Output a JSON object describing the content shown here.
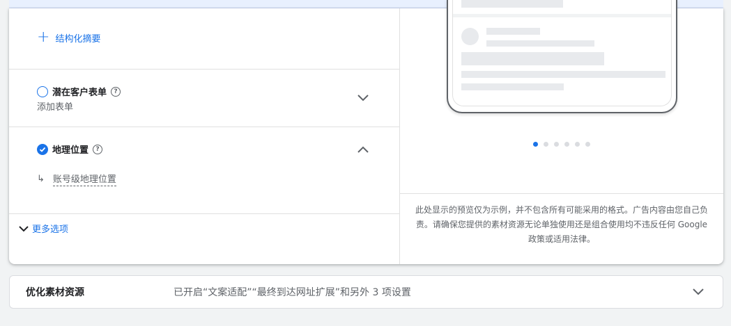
{
  "structured_snippet": {
    "label": "结构化摘要"
  },
  "lead_form": {
    "title": "潜在客户表单",
    "subtitle": "添加表单",
    "help": "?"
  },
  "location": {
    "title": "地理位置",
    "link": "账号级地理位置",
    "arrow": "↳",
    "help": "?"
  },
  "more_options": {
    "label": "更多选项"
  },
  "preview": {
    "disclaimer": "此处显示的预览仅为示例，并不包含所有可能采用的格式。广告内容由您自己负责。请确保您提供的素材资源无论单独使用还是组合使用均不违反任何 Google 政策或适用法律。",
    "dot_count": 6,
    "active_dot": 1
  },
  "optimized_assets": {
    "title": "优化素材资源",
    "summary": "已开启“文案适配”“最终到达网址扩展”和另外 3 项设置"
  },
  "colors": {
    "accent": "#1a73e8",
    "text": "#202124",
    "secondary": "#5f6368"
  }
}
